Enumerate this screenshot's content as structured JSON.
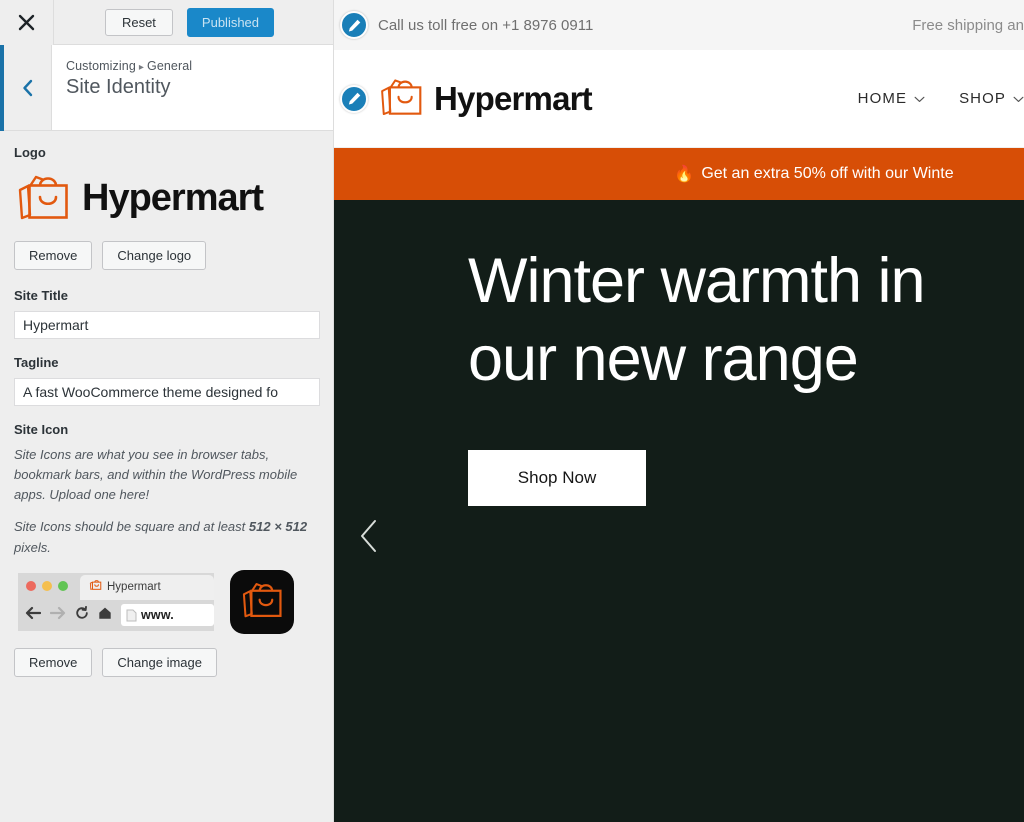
{
  "customizer": {
    "close_icon": "close-icon",
    "reset_label": "Reset",
    "publish_label": "Published",
    "back_icon": "chevron-left-icon",
    "breadcrumb_root": "Customizing",
    "breadcrumb_sep": "▸",
    "breadcrumb_parent": "General",
    "panel_title": "Site Identity",
    "logo": {
      "label": "Logo",
      "wordmark": "Hypermart",
      "remove_label": "Remove",
      "change_label": "Change logo"
    },
    "site_title": {
      "label": "Site Title",
      "value": "Hypermart"
    },
    "tagline": {
      "label": "Tagline",
      "value": "A fast WooCommerce theme designed fo"
    },
    "site_icon": {
      "label": "Site Icon",
      "description_1": "Site Icons are what you see in browser tabs, bookmark bars, and within the WordPress mobile apps. Upload one here!",
      "description_2_pre": "Site Icons should be square and at least ",
      "description_2_strong": "512 × 512",
      "description_2_post": " pixels.",
      "browser_tab_title": "Hypermart",
      "browser_url_text": "www.",
      "remove_label": "Remove",
      "change_label": "Change image"
    }
  },
  "preview": {
    "topbar": {
      "phone_text": "Call us toll free on +1 8976 0911",
      "shipping_text": "Free shipping an"
    },
    "header": {
      "wordmark": "Hypermart",
      "nav": [
        {
          "label": "HOME",
          "caret": "chevron-down-icon"
        },
        {
          "label": "SHOP",
          "caret": "chevron-down-icon"
        }
      ]
    },
    "promo": {
      "flame": "🔥",
      "text": "Get an extra 50% off with our Winte"
    },
    "hero": {
      "title": "Winter warmth in our new range",
      "cta_label": "Shop Now",
      "prev_arrow": "chevron-left-icon"
    }
  },
  "colors": {
    "publish_blue": "#1a88c9",
    "accent_blue": "#1a72a8",
    "brand_orange": "#e2590f",
    "promo_orange": "#d74e06",
    "hero_dark": "#121d18"
  }
}
